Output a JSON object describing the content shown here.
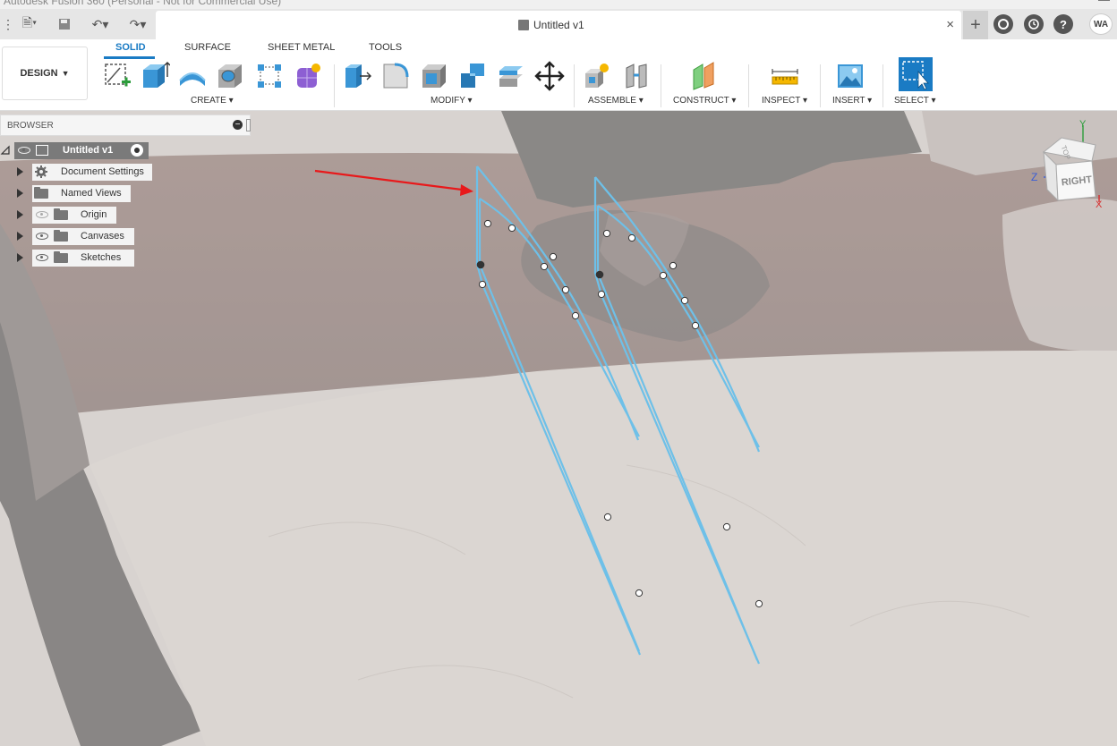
{
  "window": {
    "title": "Autodesk Fusion 360 (Personal - Not for Commercial Use)"
  },
  "document": {
    "tab_title": "Untitled v1",
    "close_label": "×"
  },
  "account": {
    "initials": "WA"
  },
  "workspace": {
    "design_label": "DESIGN"
  },
  "tabs": [
    {
      "label": "SOLID",
      "active": true
    },
    {
      "label": "SURFACE",
      "active": false
    },
    {
      "label": "SHEET METAL",
      "active": false
    },
    {
      "label": "TOOLS",
      "active": false
    }
  ],
  "groups": [
    {
      "label": "CREATE ▾"
    },
    {
      "label": "MODIFY ▾"
    },
    {
      "label": "ASSEMBLE ▾"
    },
    {
      "label": "CONSTRUCT ▾"
    },
    {
      "label": "INSPECT ▾"
    },
    {
      "label": "INSERT ▾"
    },
    {
      "label": "SELECT ▾"
    }
  ],
  "browser": {
    "header": "BROWSER",
    "root": "Untitled v1",
    "items": [
      {
        "label": "Document Settings",
        "icon": "gear-icon",
        "visible": true
      },
      {
        "label": "Named Views",
        "icon": "folder-icon",
        "visible": true
      },
      {
        "label": "Origin",
        "icon": "folder-icon",
        "visible": false
      },
      {
        "label": "Canvases",
        "icon": "folder-icon",
        "visible": true
      },
      {
        "label": "Sketches",
        "icon": "folder-icon",
        "visible": true
      }
    ]
  },
  "viewcube": {
    "face_front": "RIGHT",
    "face_top": "TOP",
    "axis_x": "X",
    "axis_y": "Y",
    "axis_z": "Z"
  },
  "colors": {
    "accent": "#1a7bc4",
    "sketch_line": "#6ec0e8",
    "annotation_arrow": "#e8191b"
  }
}
